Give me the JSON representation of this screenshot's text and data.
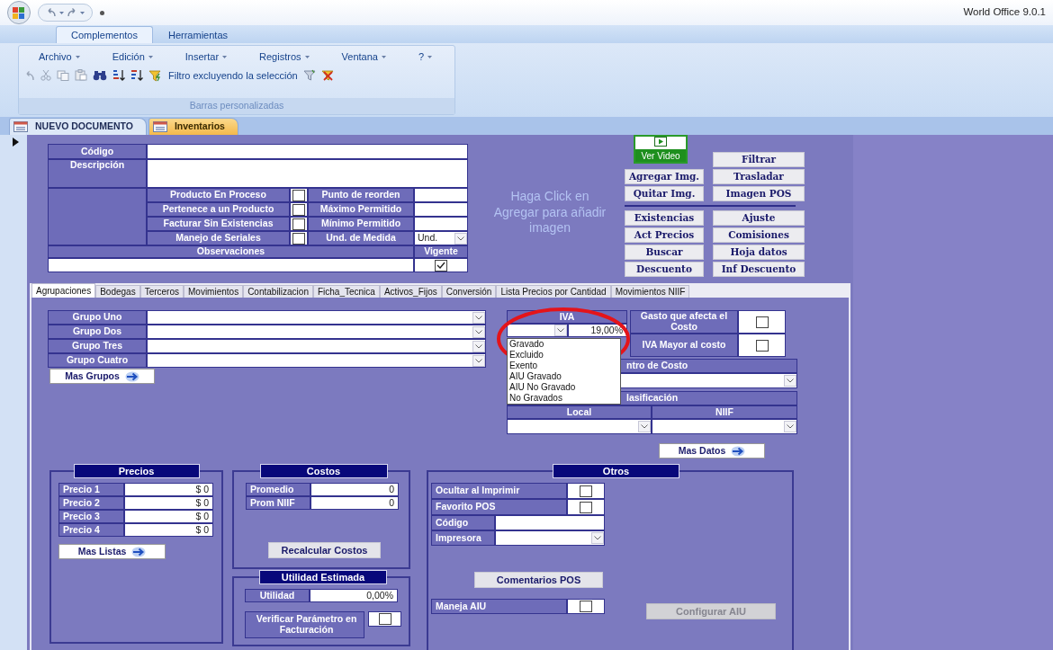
{
  "window": {
    "title": "World Office 9.0.1"
  },
  "ribbon": {
    "tabs": [
      {
        "label": "Complementos",
        "selected": true
      },
      {
        "label": "Herramientas",
        "selected": false
      }
    ],
    "menus": [
      "Archivo",
      "Edición",
      "Insertar",
      "Registros",
      "Ventana",
      "?"
    ],
    "filter_label": "Filtro excluyendo la selección",
    "group_label": "Barras personalizadas"
  },
  "document_tabs": [
    {
      "label": "NUEVO DOCUMENTO",
      "selected": false
    },
    {
      "label": "Inventarios",
      "selected": true
    }
  ],
  "header": {
    "code_label": "Código",
    "description_label": "Descripción",
    "flags": [
      {
        "label": "Producto En Proceso",
        "checked": false,
        "field_label": "Punto de reorden",
        "kind": "text"
      },
      {
        "label": "Pertenece a un Producto",
        "checked": false,
        "field_label": "Máximo Permitido",
        "kind": "text"
      },
      {
        "label": "Facturar Sin Existencias",
        "checked": false,
        "field_label": "Mínimo Permitido",
        "kind": "text"
      },
      {
        "label": "Manejo de Seriales",
        "checked": false,
        "field_label": "Und. de Medida",
        "kind": "dropdown",
        "value": "Und."
      }
    ],
    "observations_label": "Observaciones",
    "active_label": "Vigente",
    "active": true
  },
  "image_hint": "Haga Click en Agregar para añadir imagen",
  "video_button": "Ver Video",
  "action_buttons": {
    "left": {
      "top": [
        "Agregar Img.",
        "Quitar Img."
      ],
      "bottom": [
        "Existencias",
        "Act Precios",
        "Buscar",
        "Descuento"
      ]
    },
    "right": {
      "top": [
        "Filtrar",
        "Trasladar",
        "Imagen POS"
      ],
      "bottom": [
        "Ajuste",
        "Comisiones",
        "Hoja datos",
        "Inf Descuento"
      ]
    }
  },
  "tabs": [
    {
      "label": "Agrupaciones",
      "selected": true
    },
    {
      "label": "Bodegas",
      "selected": false
    },
    {
      "label": "Terceros",
      "selected": false
    },
    {
      "label": "Movimientos",
      "selected": false
    },
    {
      "label": "Contabilizacion",
      "selected": false
    },
    {
      "label": "Ficha_Tecnica",
      "selected": false
    },
    {
      "label": "Activos_Fijos",
      "selected": false
    },
    {
      "label": "Conversión",
      "selected": false
    },
    {
      "label": "Lista Precios por Cantidad",
      "selected": false
    },
    {
      "label": "Movimientos NIIF",
      "selected": false
    }
  ],
  "groups": {
    "rows": [
      "Grupo Uno",
      "Grupo Dos",
      "Grupo Tres",
      "Grupo Cuatro"
    ],
    "more_button": "Mas Grupos"
  },
  "iva": {
    "label": "IVA",
    "rate": "19,00%",
    "options": [
      "Gravado",
      "Excluido",
      "Exento",
      "AIU Gravado",
      "AIU No Gravado",
      "No Gravados"
    ]
  },
  "cost_flags": [
    {
      "label": "Gasto que afecta el Costo",
      "checked": false
    },
    {
      "label": "IVA Mayor al costo",
      "checked": false
    }
  ],
  "cost_center": {
    "label": "ntro de Costo"
  },
  "classification": {
    "label": "lasificación",
    "columns": [
      "Local",
      "NIIF"
    ]
  },
  "more_data_button": "Mas Datos",
  "prices": {
    "title": "Precios",
    "rows": [
      {
        "label": "Precio 1",
        "value": "$ 0"
      },
      {
        "label": "Precio 2",
        "value": "$ 0"
      },
      {
        "label": "Precio 3",
        "value": "$ 0"
      },
      {
        "label": "Precio 4",
        "value": "$ 0"
      }
    ],
    "more_button": "Mas Listas"
  },
  "costs": {
    "title": "Costos",
    "rows": [
      {
        "label": "Promedio",
        "value": "0"
      },
      {
        "label": "Prom NIIF",
        "value": "0"
      }
    ],
    "button": "Recalcular Costos"
  },
  "utility": {
    "title": "Utilidad Estimada",
    "label": "Utilidad",
    "value": "0,00%",
    "verify_label": "Verificar Parámetro en Facturación",
    "verify_checked": false
  },
  "others": {
    "title": "Otros",
    "checks": [
      {
        "label": "Ocultar al Imprimir",
        "checked": false
      },
      {
        "label": "Favorito POS",
        "checked": false
      }
    ],
    "code_label": "Código",
    "printer_label": "Impresora",
    "comments_button": "Comentarios POS",
    "aiu_label": "Maneja AIU",
    "aiu_checked": false,
    "configure_button": "Configurar AIU",
    "configure_disabled": true
  }
}
